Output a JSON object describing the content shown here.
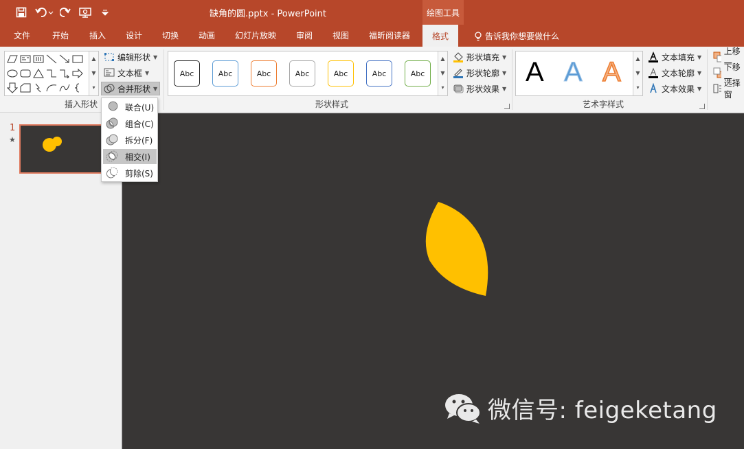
{
  "window": {
    "title": "缺角的圆.pptx - PowerPoint",
    "context_tab_group": "绘图工具"
  },
  "tabs": [
    {
      "label": "文件"
    },
    {
      "label": "开始"
    },
    {
      "label": "插入"
    },
    {
      "label": "设计"
    },
    {
      "label": "切换"
    },
    {
      "label": "动画"
    },
    {
      "label": "幻灯片放映"
    },
    {
      "label": "审阅"
    },
    {
      "label": "视图"
    },
    {
      "label": "福昕阅读器"
    },
    {
      "label": "格式",
      "active": true
    }
  ],
  "tell_me": "告诉我你想要做什么",
  "ribbon": {
    "insert_shapes": {
      "label": "插入形状",
      "edit_shape": "编辑形状",
      "text_box": "文本框",
      "merge_shapes": "合并形状"
    },
    "shape_styles": {
      "label": "形状样式",
      "swatches": [
        {
          "text": "Abc",
          "border": "#222222"
        },
        {
          "text": "Abc",
          "border": "#5b9bd5"
        },
        {
          "text": "Abc",
          "border": "#ed7d31"
        },
        {
          "text": "Abc",
          "border": "#a5a5a5"
        },
        {
          "text": "Abc",
          "border": "#ffc000"
        },
        {
          "text": "Abc",
          "border": "#4472c4"
        },
        {
          "text": "Abc",
          "border": "#70ad47"
        }
      ],
      "fill": "形状填充",
      "outline": "形状轮廓",
      "effects": "形状效果"
    },
    "wordart_styles": {
      "label": "艺术字样式",
      "samples": [
        "A",
        "A",
        "A"
      ],
      "text_fill": "文本填充",
      "text_outline": "文本轮廓",
      "text_effects": "文本效果"
    },
    "arrange": {
      "bring_forward": "上移一",
      "send_backward": "下移一",
      "selection_pane": "选择窗"
    }
  },
  "merge_menu": {
    "items": [
      {
        "label": "联合(U)"
      },
      {
        "label": "组合(C)"
      },
      {
        "label": "拆分(F)"
      },
      {
        "label": "相交(I)",
        "hovered": true
      },
      {
        "label": "剪除(S)"
      }
    ]
  },
  "thumbnails": {
    "slide_number": "1",
    "star": "★"
  },
  "canvas": {
    "background": "#383635",
    "shape_color": "#ffc000",
    "watermark": "微信号: feigeketang"
  },
  "colors": {
    "accent": "#b7472a"
  }
}
